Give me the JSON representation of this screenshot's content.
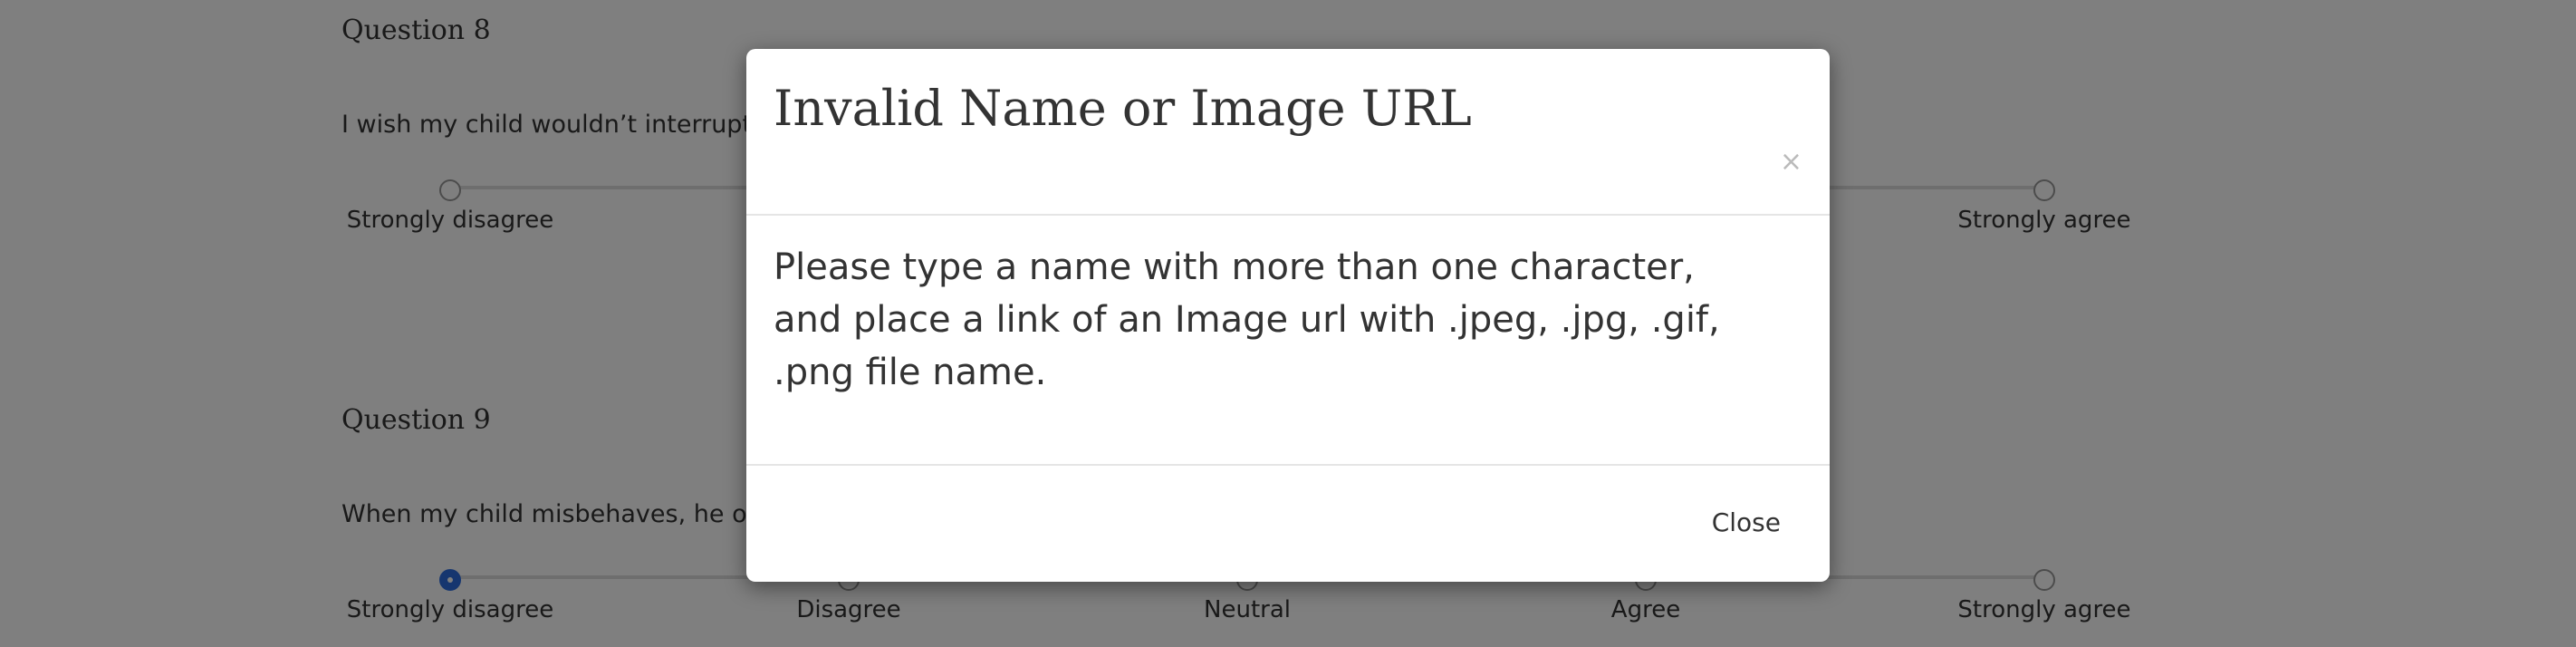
{
  "questions": [
    {
      "title": "Question 8",
      "text": "I wish my child wouldn’t interrupt m",
      "visible_options": [
        {
          "label": "Strongly disagree",
          "selected": false
        },
        {
          "label": "Strongly agree",
          "selected": false
        }
      ]
    },
    {
      "title": "Question 9",
      "text": "When my child misbehaves, he or sh",
      "options": [
        {
          "label": "Strongly disagree",
          "selected": true
        },
        {
          "label": "Disagree",
          "selected": false
        },
        {
          "label": "Neutral",
          "selected": false
        },
        {
          "label": "Agree",
          "selected": false
        },
        {
          "label": "Strongly agree",
          "selected": false
        }
      ]
    }
  ],
  "modal": {
    "title": "Invalid Name or Image URL",
    "close_icon": "×",
    "body": "Please type a name with more than one character, and place a link of an Image url with .jpeg, .jpg, .gif, .png file name.",
    "close_button_label": "Close"
  },
  "colors": {
    "accent": "#2d6cdf",
    "overlay": "rgba(0,0,0,0.5)"
  },
  "icons": {
    "modal_close": "close-icon"
  }
}
